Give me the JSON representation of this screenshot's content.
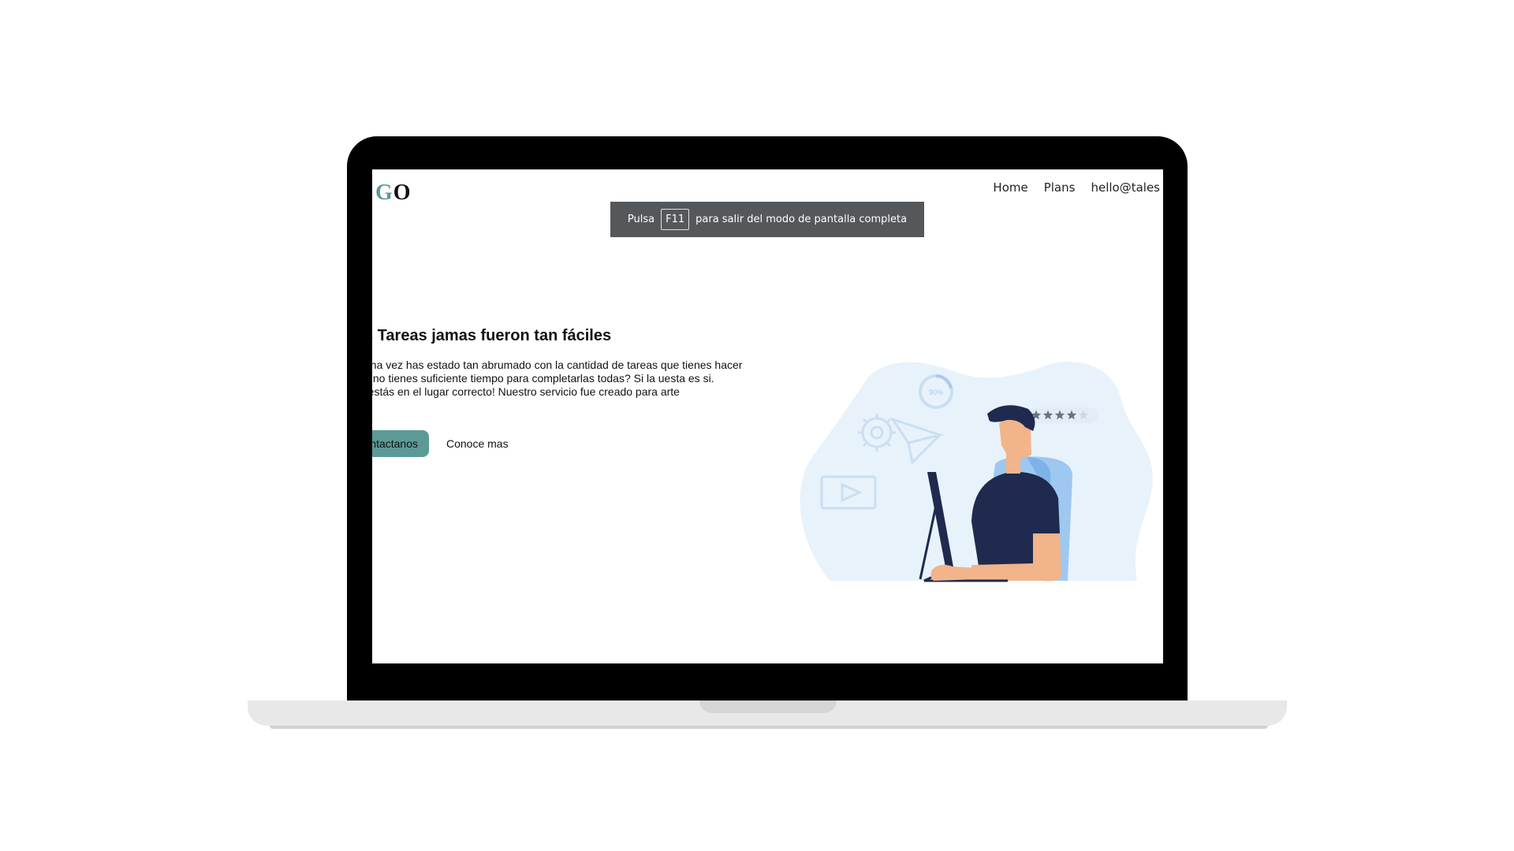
{
  "site": {
    "logo": {
      "accent_letter": "G",
      "rest": "O"
    },
    "nav": [
      "Home",
      "Plans",
      "hello@tales"
    ]
  },
  "fullscreen_notice": {
    "before": "Pulsa",
    "key": "F11",
    "after": "para salir del modo de pantalla completa"
  },
  "hero": {
    "title": "s Tareas jamas fueron tan fáciles",
    "body": "una vez has estado tan abrumado con la cantidad de tareas que tienes hacer y no tienes suficiente tiempo para completarlas todas? Si la uesta es si. ¡estás en el lugar correcto! Nuestro servicio fue creado para arte",
    "primary_button": "ntactanos",
    "secondary_button": "Conoce mas"
  },
  "illustration": {
    "progress_label": "90%",
    "rating": 4,
    "rating_max": 5,
    "icons": [
      "gear-icon",
      "paper-plane-icon",
      "video-play-icon",
      "progress-ring-icon",
      "star-rating-icon"
    ]
  },
  "colors": {
    "accent": "#5b9a97",
    "banner_bg": "#55585b",
    "blob": "#e8f2fb",
    "shirt": "#1f2a4e",
    "chair": "#9ec8f0",
    "skin": "#f2b48a"
  }
}
